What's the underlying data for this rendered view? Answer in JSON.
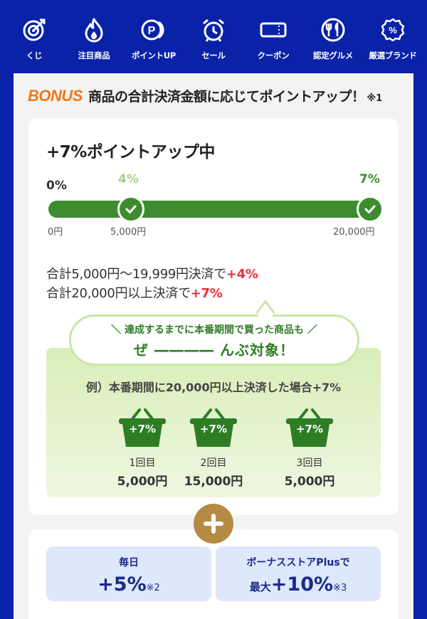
{
  "nav": {
    "items": [
      {
        "label": "くじ",
        "icon": "target-icon"
      },
      {
        "label": "注目商品",
        "icon": "fire-icon"
      },
      {
        "label": "ポイントUP",
        "icon": "points-icon"
      },
      {
        "label": "セール",
        "icon": "alarm-clock-icon"
      },
      {
        "label": "クーポン",
        "icon": "coupon-icon"
      },
      {
        "label": "認定グルメ",
        "icon": "dish-icon"
      },
      {
        "label": "厳選ブランド",
        "icon": "percent-badge-icon"
      }
    ]
  },
  "bonus": {
    "logo": "BONUS",
    "title": "商品の合計決済金額に応じてポイントアップ！",
    "note": "※1"
  },
  "progress": {
    "title": "+7%ポイントアップ中",
    "start_pct": "0%",
    "mid_pct": "4%",
    "end_pct": "7%",
    "ticks": [
      "0円",
      "5,000円",
      "20,000円"
    ],
    "fill_fraction": 1.0,
    "colors": {
      "fill": "#3d8c2f",
      "mid_label": "#a8d08d",
      "end_label": "#3d8c2f"
    }
  },
  "conditions": {
    "line1_prefix": "合計5,000円〜19,999円決済で",
    "line1_value": "+4%",
    "line2_prefix": "合計20,000円以上決済で",
    "line2_value": "+7%"
  },
  "bubble": {
    "line1": "＼ 達成するまでに本番期間で買った商品も ／",
    "line2": "ぜ ―――― んぶ対象！"
  },
  "example": {
    "text": "例）本番期間に20,000円以上決済した場合+7%",
    "baskets": [
      {
        "badge": "+7%",
        "label": "1回目",
        "amount": "5,000円"
      },
      {
        "badge": "+7%",
        "label": "2回目",
        "amount": "15,000円"
      },
      {
        "badge": "+7%",
        "label": "3回目",
        "amount": "5,000円"
      }
    ]
  },
  "extras": {
    "daily": {
      "title": "毎日",
      "value": "+5%",
      "note": "※2"
    },
    "store": {
      "title": "ボーナスストアPlusで",
      "prefix": "最大",
      "value": "+10%",
      "note": "※3"
    }
  }
}
